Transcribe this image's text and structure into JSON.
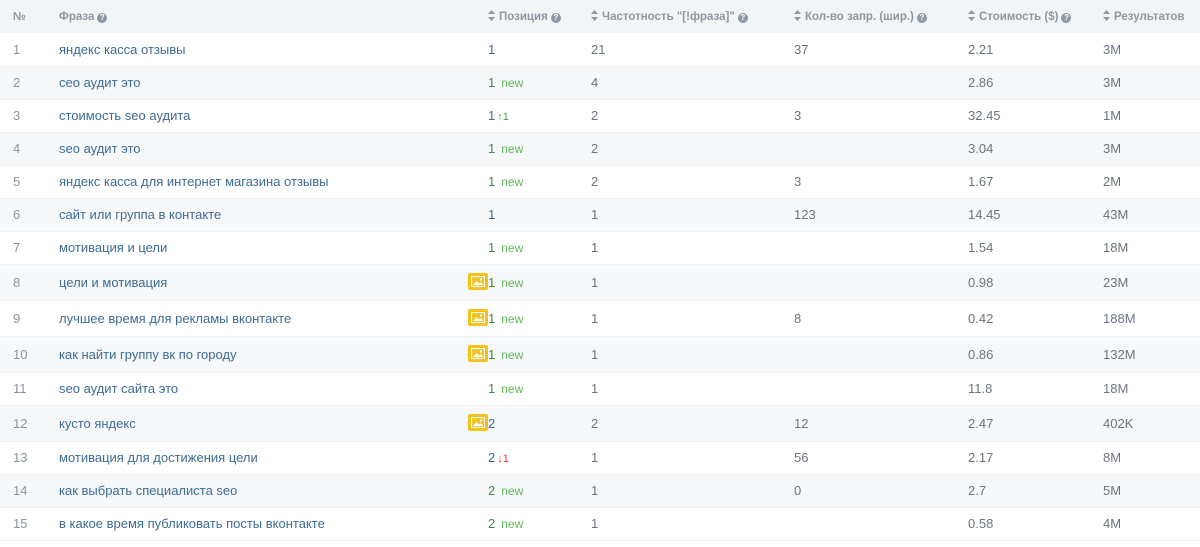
{
  "headers": {
    "num": "№",
    "phrase": "Фраза",
    "position": "Позиция",
    "frequency": "Частотность \"[!фраза]\"",
    "broad": "Кол-во запр. (шир.)",
    "cost": "Стоимость ($)",
    "results": "Результатов"
  },
  "rows": [
    {
      "num": "1",
      "phrase": "яндекс касса отзывы",
      "pos": "1",
      "badge": "",
      "change": "",
      "freq": "21",
      "broad": "37",
      "cost": "2.21",
      "results": "3M"
    },
    {
      "num": "2",
      "phrase": "сео аудит это",
      "pos": "1",
      "badge": "new",
      "change": "",
      "freq": "4",
      "broad": "",
      "cost": "2.86",
      "results": "3M"
    },
    {
      "num": "3",
      "phrase": "стоимость seo аудита",
      "pos": "1",
      "badge": "",
      "change": "1",
      "freq": "2",
      "broad": "3",
      "cost": "32.45",
      "results": "1M"
    },
    {
      "num": "4",
      "phrase": "seo аудит это",
      "pos": "1",
      "badge": "new",
      "change": "",
      "freq": "2",
      "broad": "",
      "cost": "3.04",
      "results": "3M"
    },
    {
      "num": "5",
      "phrase": "яндекс касса для интернет магазина отзывы",
      "pos": "1",
      "badge": "new",
      "change": "",
      "freq": "2",
      "broad": "3",
      "cost": "1.67",
      "results": "2M"
    },
    {
      "num": "6",
      "phrase": "сайт или группа в контакте",
      "pos": "1",
      "badge": "",
      "change": "",
      "freq": "1",
      "broad": "123",
      "cost": "14.45",
      "results": "43M"
    },
    {
      "num": "7",
      "phrase": "мотивация и цели",
      "pos": "1",
      "badge": "new",
      "change": "",
      "freq": "1",
      "broad": "",
      "cost": "1.54",
      "results": "18M"
    },
    {
      "num": "8",
      "phrase": "цели и мотивация",
      "pos": "1",
      "badge": "new",
      "change": "",
      "freq": "1",
      "broad": "",
      "cost": "0.98",
      "results": "23M",
      "image": true
    },
    {
      "num": "9",
      "phrase": "лучшее время для рекламы вконтакте",
      "pos": "1",
      "badge": "new",
      "change": "",
      "freq": "1",
      "broad": "8",
      "cost": "0.42",
      "results": "188M",
      "image": true
    },
    {
      "num": "10",
      "phrase": "как найти группу вк по городу",
      "pos": "1",
      "badge": "new",
      "change": "",
      "freq": "1",
      "broad": "",
      "cost": "0.86",
      "results": "132M",
      "image": true
    },
    {
      "num": "11",
      "phrase": "seo аудит сайта это",
      "pos": "1",
      "badge": "new",
      "change": "",
      "freq": "1",
      "broad": "",
      "cost": "11.8",
      "results": "18M"
    },
    {
      "num": "12",
      "phrase": "кусто яндекс",
      "pos": "2",
      "badge": "",
      "change": "",
      "freq": "2",
      "broad": "12",
      "cost": "2.47",
      "results": "402K",
      "image": true
    },
    {
      "num": "13",
      "phrase": "мотивация для достижения цели",
      "pos": "2",
      "badge": "",
      "change": "-1",
      "freq": "1",
      "broad": "56",
      "cost": "2.17",
      "results": "8M"
    },
    {
      "num": "14",
      "phrase": "как выбрать специалиста seo",
      "pos": "2",
      "badge": "new",
      "change": "",
      "freq": "1",
      "broad": "0",
      "cost": "2.7",
      "results": "5M"
    },
    {
      "num": "15",
      "phrase": "в какое время публиковать посты вконтакте",
      "pos": "2",
      "badge": "new",
      "change": "",
      "freq": "1",
      "broad": "",
      "cost": "0.58",
      "results": "4M"
    }
  ],
  "colors": {
    "header_bg": "#f3f4f5",
    "row_alt_bg": "#f7f8f9",
    "link": "#3d6c96",
    "new_badge": "#5fb85a",
    "up": "#43a047",
    "down": "#e53935",
    "image_icon": "#f4c21b"
  },
  "icons": {
    "help": "question-circle-icon",
    "sort": "sort-arrows-icon",
    "image": "image-icon",
    "up": "arrow-up-icon",
    "down": "arrow-down-icon"
  }
}
